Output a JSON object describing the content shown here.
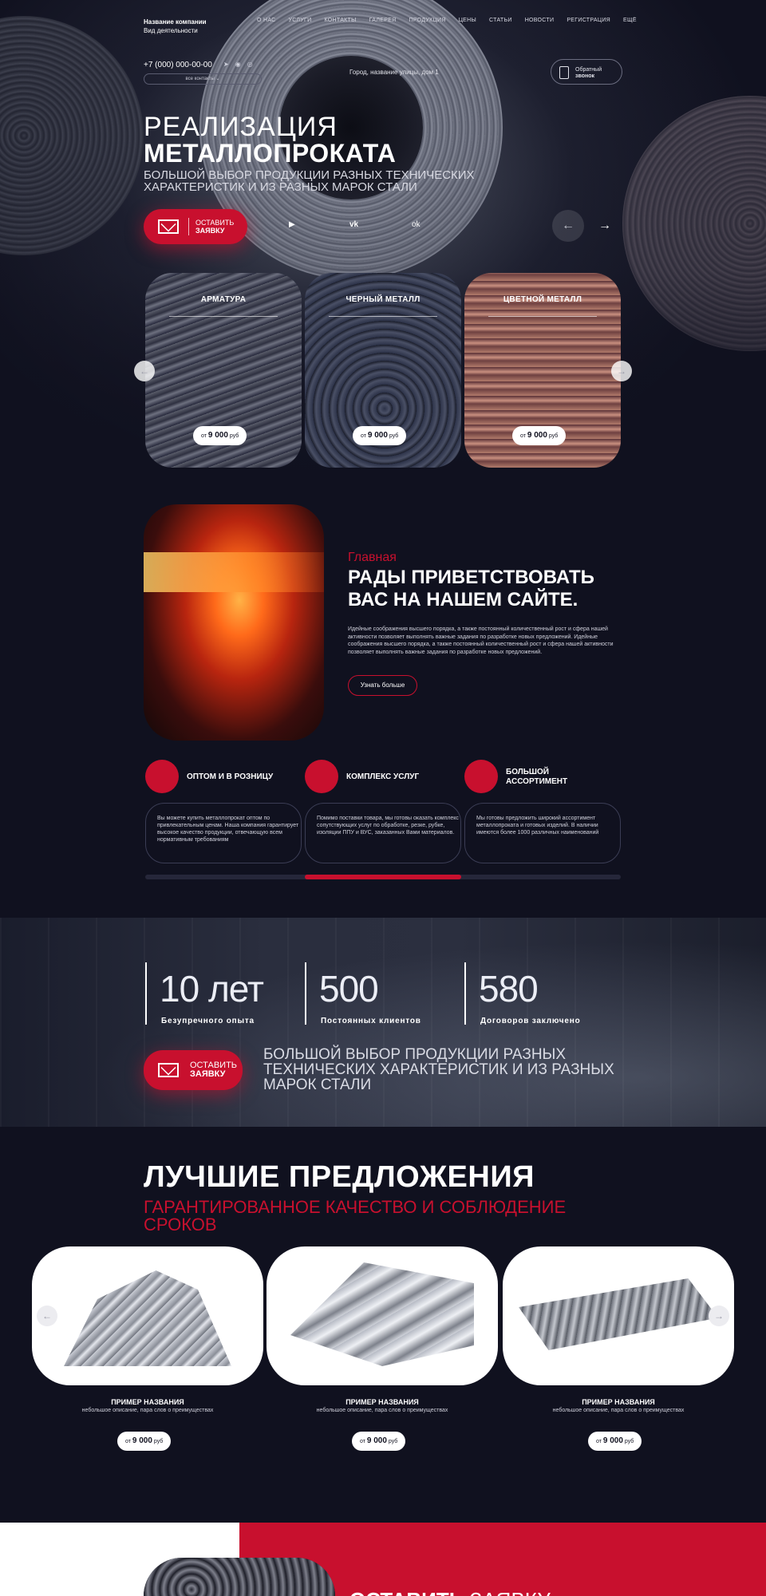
{
  "header": {
    "company_name": "Название компании",
    "company_activity": "Вид деятельности",
    "nav": [
      "О НАС",
      "УСЛУГИ",
      "КОНТАКТЫ",
      "ГАЛЕРЕЯ",
      "ПРОДУКЦИЯ",
      "ЦЕНЫ",
      "СТАТЬИ",
      "НОВОСТИ",
      "РЕГИСТРАЦИЯ",
      "ЕЩЁ"
    ],
    "phone": "+7 (000) 000-00-00",
    "all_contacts": "все контакты",
    "address": "Город, название улицы, дом 1",
    "callback_line1": "Обратный",
    "callback_line2": "звонок"
  },
  "hero": {
    "title_light": "РЕАЛИЗАЦИЯ",
    "title_bold": "МЕТАЛЛОПРОКАТА",
    "subtitle": "БОЛЬШОЙ ВЫБОР ПРОДУКЦИИ РАЗНЫХ ТЕХНИЧЕСКИХ ХАРАКТЕРИСТИК И ИЗ РАЗНЫХ МАРОК СТАЛИ",
    "cta_line1": "ОСТАВИТЬ",
    "cta_line2": "ЗАЯВКУ",
    "social_icons": [
      "youtube-icon",
      "vk-icon",
      "odnoklassniki-icon"
    ],
    "arrow_prev": "←",
    "arrow_next": "→"
  },
  "categories": [
    {
      "title": "АРМАТУРА",
      "price_prefix": "от",
      "price": "9 000",
      "price_unit": "руб"
    },
    {
      "title": "ЧЕРНЫЙ МЕТАЛЛ",
      "price_prefix": "от",
      "price": "9 000",
      "price_unit": "руб"
    },
    {
      "title": "ЦВЕТНОЙ МЕТАЛЛ",
      "price_prefix": "от",
      "price": "9 000",
      "price_unit": "руб"
    }
  ],
  "welcome": {
    "kicker": "Главная",
    "heading": "РАДЫ ПРИВЕТСТВОВАТЬ ВАС НА НАШЕМ САЙТЕ.",
    "text": "Идейные соображения высшего порядка, а также постоянный количественный рост и сфера нашей активности позволяет выполнять важные задания по разработке новых предложений. Идейные соображения высшего порядка, а также постоянный количественный рост и сфера нашей активности позволяет выполнять важные задания по разработке новых предложений.",
    "more_button": "Узнать больше"
  },
  "features": [
    {
      "title": "ОПТОМ И В РОЗНИЦУ",
      "text": "Вы можете купить металлопрокат оптом по привлекательным ценам. Наша компания гарантирует высокое качество продукции, отвечающую всем нормативным требованиям"
    },
    {
      "title": "КОМПЛЕКС УСЛУГ",
      "text": "Помимо поставки товара, мы готовы оказать комплекс сопутствующих услуг по обработке, резке, рубке, изоляции ППУ и ВУС, заказанных Вами материалов."
    },
    {
      "title": "БОЛЬШОЙ АССОРТИМЕНТ",
      "text": "Мы готовы предложить широкий ассортимент металлопроката и готовых изделий. В наличии имеются более 1000 различных наименований"
    }
  ],
  "features_slider_position": 0.5,
  "stats": [
    {
      "value": "10 лет",
      "label": "Безупречного опыта"
    },
    {
      "value": "500",
      "label": "Постоянных клиентов"
    },
    {
      "value": "580",
      "label": "Договоров заключено"
    }
  ],
  "band": {
    "cta_line1": "ОСТАВИТЬ",
    "cta_line2": "ЗАЯВКУ",
    "text": "БОЛЬШОЙ ВЫБОР ПРОДУКЦИИ РАЗНЫХ ТЕХНИЧЕСКИХ ХАРАКТЕРИСТИК И ИЗ РАЗНЫХ МАРОК СТАЛИ"
  },
  "offers": {
    "heading": "ЛУЧШИЕ ПРЕДЛОЖЕНИЯ",
    "subheading": "ГАРАНТИРОВАННОЕ КАЧЕСТВО И СОБЛЮДЕНИЕ СРОКОВ",
    "products": [
      {
        "name": "ПРИМЕР НАЗВАНИЯ",
        "desc": "небольшое описание, пара слов о преимуществах",
        "price_prefix": "от",
        "price": "9 000",
        "price_unit": "руб"
      },
      {
        "name": "ПРИМЕР НАЗВАНИЯ",
        "desc": "небольшое описание, пара слов о преимуществах",
        "price_prefix": "от",
        "price": "9 000",
        "price_unit": "руб"
      },
      {
        "name": "ПРИМЕР НАЗВАНИЯ",
        "desc": "небольшое описание, пара слов о преимуществах",
        "price_prefix": "от",
        "price": "9 000",
        "price_unit": "руб"
      }
    ]
  },
  "bottom": {
    "heading_bold": "ОСТАВИТЬ",
    "heading_light": "ЗАЯВКУ"
  },
  "colors": {
    "accent": "#c8102e",
    "background": "#10111f",
    "white": "#ffffff"
  }
}
